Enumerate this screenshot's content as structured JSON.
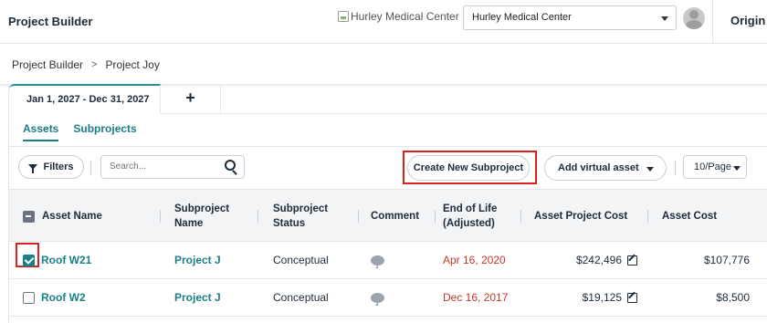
{
  "header": {
    "app_title": "Project Builder",
    "org_logo_alt": "Hurley Medical Center",
    "org_select_value": "Hurley Medical Center",
    "origin_label": "Origin"
  },
  "breadcrumb": {
    "items": [
      "Project Builder",
      "Project Joy"
    ],
    "separator": ">"
  },
  "date_tabs": {
    "active_range": "Jan 1, 2027 - Dec 31, 2027",
    "add_label": "+"
  },
  "sub_tabs": [
    {
      "label": "Assets",
      "active": true
    },
    {
      "label": "Subprojects",
      "active": false
    }
  ],
  "toolbar": {
    "filters_label": "Filters",
    "search_placeholder": "Search...",
    "create_subproject_label": "Create New Subproject",
    "add_virtual_asset_label": "Add virtual asset",
    "page_size": "10/Page"
  },
  "table": {
    "columns": {
      "asset_name": "Asset Name",
      "subproject_name": "Subproject Name",
      "subproject_status": "Subproject Status",
      "comment": "Comment",
      "end_of_life": "End of Life (Adjusted)",
      "asset_project_cost": "Asset Project Cost",
      "asset_cost": "Asset Cost"
    },
    "rows": [
      {
        "checked": true,
        "asset_name": "Roof W21",
        "subproject_name": "Project J",
        "status": "Conceptual",
        "end_of_life": "Apr 16, 2020",
        "asset_project_cost": "$242,496",
        "asset_cost": "$107,776"
      },
      {
        "checked": false,
        "asset_name": "Roof W2",
        "subproject_name": "Project J",
        "status": "Conceptual",
        "end_of_life": "Dec 16, 2017",
        "asset_project_cost": "$19,125",
        "asset_cost": "$8,500"
      }
    ]
  },
  "colors": {
    "accent_teal": "#1a7f86",
    "overdue_red": "#c0392b",
    "annotation_red": "#d8201f"
  }
}
